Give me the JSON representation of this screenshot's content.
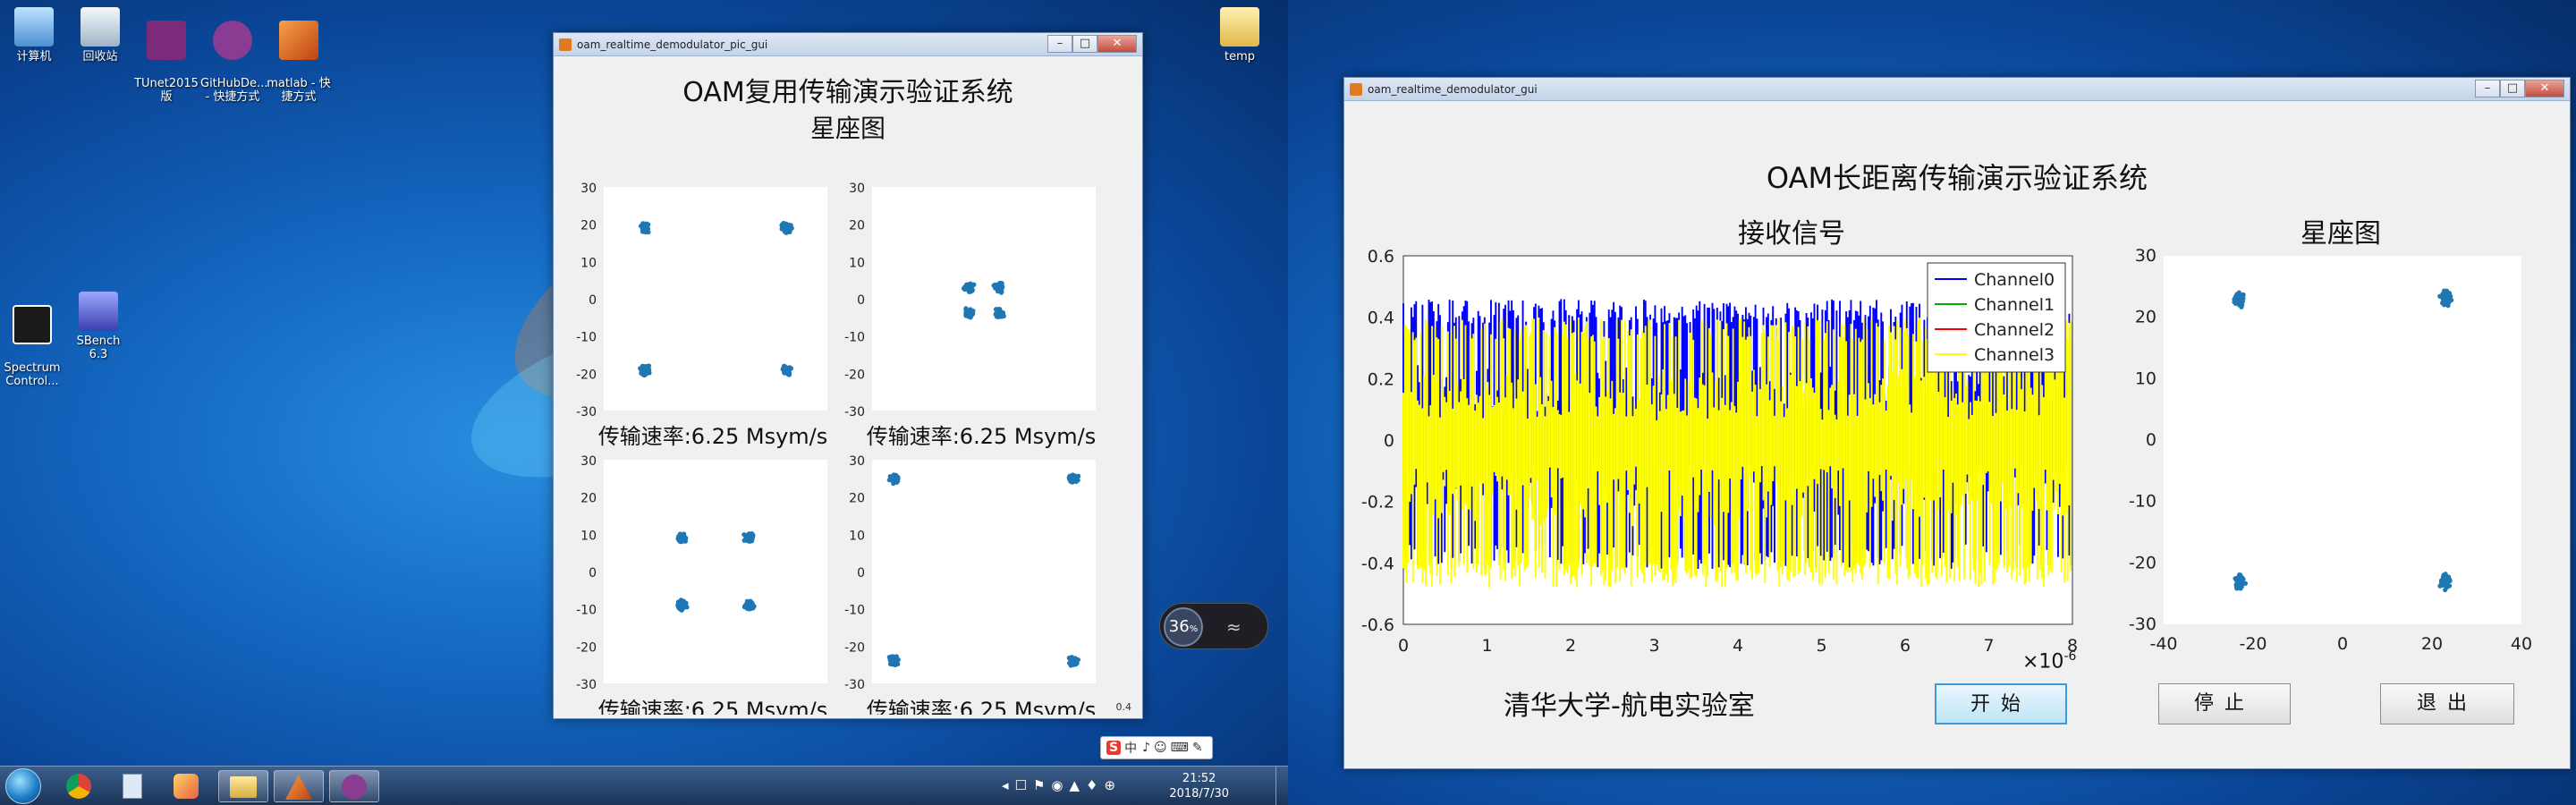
{
  "desktop": {
    "icons": [
      {
        "label": "计算机"
      },
      {
        "label": "回收站"
      },
      {
        "label": "TUnet2015\n版"
      },
      {
        "label": "GitHubDe...\n- 快捷方式"
      },
      {
        "label": "matlab - 快\n捷方式"
      },
      {
        "label": "Spectrum\nControl..."
      },
      {
        "label": "SBench 6.3"
      },
      {
        "label": "temp"
      }
    ],
    "net_widget": {
      "percent": "36",
      "unit": "%"
    }
  },
  "win_left": {
    "title": "oam_realtime_demodulator_pic_gui",
    "heading": "OAM复用传输演示验证系统",
    "subheading": "星座图",
    "rate_label": "传输速率:6.25 Msym/s",
    "corner_text": "0.4"
  },
  "win_right": {
    "title": "oam_realtime_demodulator_gui",
    "heading": "OAM长距离传输演示验证系统",
    "signal_title": "接收信号",
    "constellation_title": "星座图",
    "exponent": "×10",
    "exponent_power": "-6",
    "lab_label": "清华大学-航电实验室",
    "buttons": {
      "start": "开始",
      "stop": "停止",
      "exit": "退出"
    }
  },
  "taskbar": {
    "time": "21:52",
    "date": "2018/7/30",
    "ime": "中"
  },
  "chart_data": [
    {
      "type": "scatter",
      "title": "",
      "ylim": [
        -30,
        30
      ],
      "yticks": [
        -30,
        -20,
        -10,
        0,
        10,
        20,
        30
      ],
      "clusters": [
        [
          -19,
          19
        ],
        [
          19,
          19
        ],
        [
          -19,
          -19
        ],
        [
          19,
          -19
        ]
      ],
      "color": "#1f77b4"
    },
    {
      "type": "scatter",
      "title": "",
      "ylim": [
        -30,
        30
      ],
      "yticks": [
        -30,
        -20,
        -10,
        0,
        10,
        20,
        30
      ],
      "clusters": [
        [
          -4,
          3
        ],
        [
          4,
          3
        ],
        [
          -4,
          -4
        ],
        [
          4,
          -4
        ]
      ],
      "color": "#1f77b4"
    },
    {
      "type": "scatter",
      "title": "",
      "ylim": [
        -30,
        30
      ],
      "yticks": [
        -30,
        -20,
        -10,
        0,
        10,
        20,
        30
      ],
      "clusters": [
        [
          -9,
          9
        ],
        [
          9,
          9
        ],
        [
          -9,
          -9
        ],
        [
          9,
          -9
        ]
      ],
      "color": "#1f77b4"
    },
    {
      "type": "scatter",
      "title": "",
      "ylim": [
        -30,
        30
      ],
      "yticks": [
        -30,
        -20,
        -10,
        0,
        10,
        20,
        30
      ],
      "clusters": [
        [
          -24,
          25
        ],
        [
          24,
          25
        ],
        [
          -24,
          -24
        ],
        [
          24,
          -24
        ]
      ],
      "color": "#1f77b4"
    },
    {
      "type": "line",
      "title": "接收信号",
      "xlim": [
        0,
        8
      ],
      "ylim": [
        -0.6,
        0.6
      ],
      "xticks": [
        0,
        1,
        2,
        3,
        4,
        5,
        6,
        7,
        8
      ],
      "yticks": [
        -0.6,
        -0.4,
        -0.2,
        0,
        0.2,
        0.4,
        0.6
      ],
      "legend_position": "top-right",
      "series": [
        {
          "name": "Channel0",
          "color": "#0000ff",
          "envelope": [
            0.42,
            -0.38
          ]
        },
        {
          "name": "Channel1",
          "color": "#00aa00",
          "envelope": [
            0.0,
            0.0
          ]
        },
        {
          "name": "Channel2",
          "color": "#ff0000",
          "envelope": [
            0.0,
            0.0
          ]
        },
        {
          "name": "Channel3",
          "color": "#ffff00",
          "envelope": [
            0.36,
            -0.44
          ]
        }
      ]
    },
    {
      "type": "scatter",
      "title": "星座图",
      "xlim": [
        -40,
        40
      ],
      "ylim": [
        -30,
        30
      ],
      "xticks": [
        -40,
        -20,
        0,
        20,
        40
      ],
      "yticks": [
        -30,
        -20,
        -10,
        0,
        10,
        20,
        30
      ],
      "clusters": [
        [
          -23,
          23
        ],
        [
          23,
          23
        ],
        [
          -23,
          -23
        ],
        [
          23,
          -23
        ]
      ],
      "color": "#1f77b4"
    }
  ]
}
